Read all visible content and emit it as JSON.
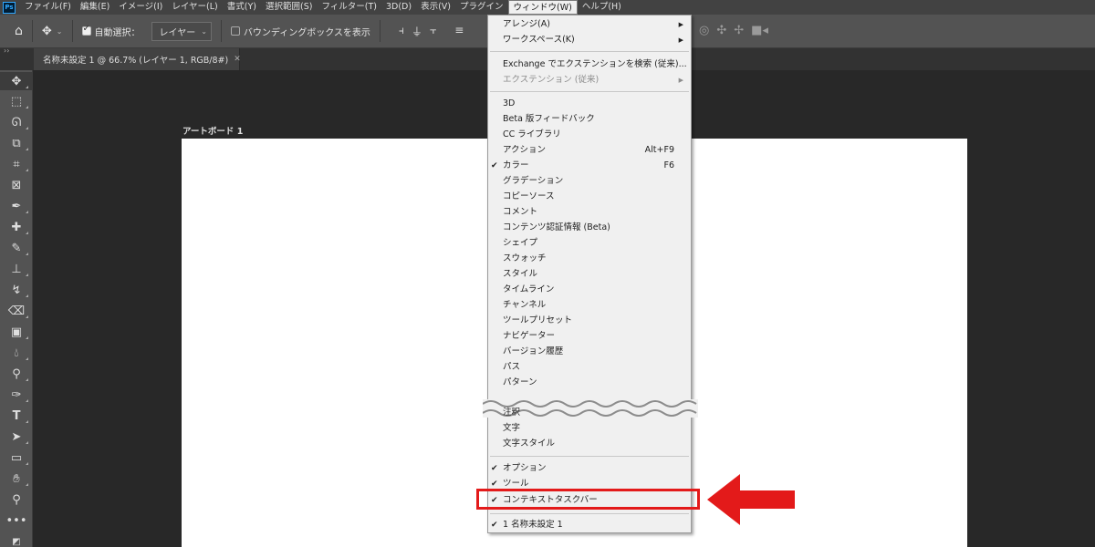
{
  "app": {
    "logo_text": "Ps"
  },
  "menubar": {
    "items": [
      "ファイル(F)",
      "編集(E)",
      "イメージ(I)",
      "レイヤー(L)",
      "書式(Y)",
      "選択範囲(S)",
      "フィルター(T)",
      "3D(D)",
      "表示(V)",
      "プラグイン",
      "ウィンドウ(W)",
      "ヘルプ(H)"
    ],
    "active_index": 10
  },
  "options": {
    "auto_select_label": "自動選択：",
    "auto_select_checked": true,
    "layer_select_value": "レイヤー",
    "bounding_box_label": "バウンディングボックスを表示",
    "bounding_box_checked": false
  },
  "document": {
    "tab_title": "名称未設定 1 @ 66.7% (レイヤー 1, RGB/8#)",
    "artboard_label": "アートボード 1"
  },
  "window_menu": {
    "group1": [
      {
        "label": "アレンジ(A)",
        "submenu": true
      },
      {
        "label": "ワークスペース(K)",
        "submenu": true
      }
    ],
    "group2": [
      {
        "label": "Exchange でエクステンションを検索 (従来)..."
      },
      {
        "label": "エクステンション (従来)",
        "submenu": true,
        "disabled": true
      }
    ],
    "group3": [
      {
        "label": "3D"
      },
      {
        "label": "Beta 版フィードバック"
      },
      {
        "label": "CC ライブラリ"
      },
      {
        "label": "アクション",
        "shortcut": "Alt+F9"
      },
      {
        "label": "カラー",
        "shortcut": "F6",
        "checked": true
      },
      {
        "label": "グラデーション"
      },
      {
        "label": "コピーソース"
      },
      {
        "label": "コメント"
      },
      {
        "label": "コンテンツ認証情報 (Beta)"
      },
      {
        "label": "シェイプ"
      },
      {
        "label": "スウォッチ"
      },
      {
        "label": "スタイル"
      },
      {
        "label": "タイムライン"
      },
      {
        "label": "チャンネル"
      },
      {
        "label": "ツールプリセット"
      },
      {
        "label": "ナビゲーター"
      },
      {
        "label": "バージョン履歴"
      },
      {
        "label": "パス"
      },
      {
        "label": "パターン"
      }
    ],
    "group4": [
      {
        "label": "注釈"
      },
      {
        "label": "文字"
      },
      {
        "label": "文字スタイル"
      }
    ],
    "group5": [
      {
        "label": "オプション",
        "checked": true
      },
      {
        "label": "ツール",
        "checked": true
      },
      {
        "label": "コンテキストタスクバー",
        "checked": true,
        "highlighted": true
      }
    ],
    "group6": [
      {
        "label": "1 名称未設定 1",
        "checked": true
      }
    ]
  },
  "colors": {
    "highlight": "#e31a1a",
    "menu_bg": "#f0f0f0",
    "ui_dark": "#282828"
  },
  "icons": [
    "home-icon",
    "move-icon",
    "chevron-down-icon",
    "align-left-icon",
    "align-center-icon",
    "align-right-icon",
    "align-top-icon",
    "arrow-left-icon",
    "check-icon"
  ]
}
